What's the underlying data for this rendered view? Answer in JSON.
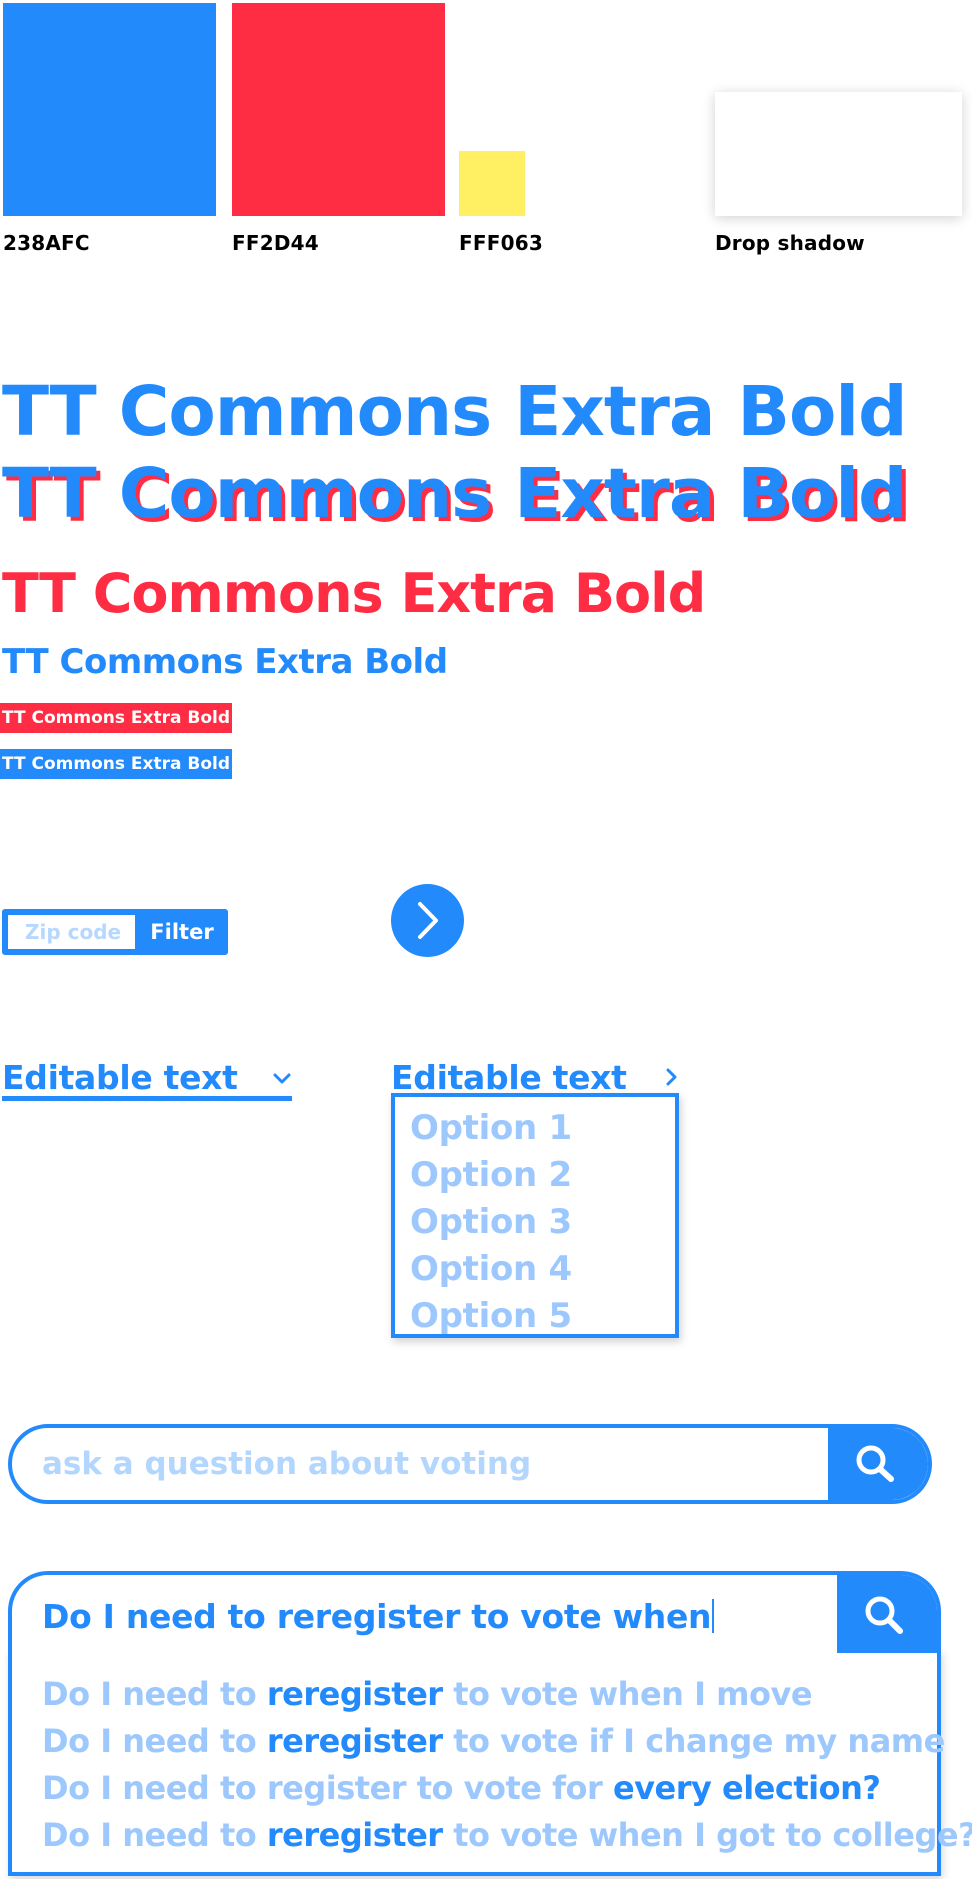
{
  "palette": {
    "swatches": [
      {
        "label": "238AFC",
        "color": "#238AFC"
      },
      {
        "label": "FF2D44",
        "color": "#FF2D44"
      },
      {
        "label": "FFF063",
        "color": "#FFF063"
      },
      {
        "label": "Drop shadow",
        "color": "#FFFFFF"
      }
    ]
  },
  "type_specimens": {
    "line1": "TT Commons Extra Bold",
    "line2": "TT Commons Extra Bold",
    "line3": "TT Commons Extra Bold",
    "line4": "TT Commons Extra Bold",
    "tag_red": "TT Commons Extra Bold",
    "tag_blue": "TT Commons Extra Bold"
  },
  "zip_filter": {
    "placeholder": "Zip code",
    "button_label": "Filter"
  },
  "next_button": {
    "icon": "chevron-right-icon"
  },
  "dropdown_closed": {
    "label": "Editable text",
    "icon": "chevron-down-icon"
  },
  "dropdown_open": {
    "label": "Editable text",
    "icon": "chevron-right-icon",
    "options": [
      "Option 1",
      "Option 2",
      "Option 3",
      "Option 4",
      "Option 5"
    ]
  },
  "search_empty": {
    "placeholder": "ask a question about voting",
    "icon": "search-icon"
  },
  "search_typing": {
    "value": "Do I need to reregister to vote when",
    "icon": "search-icon",
    "suggestions": [
      {
        "pre": "Do I need to ",
        "bold": "reregister",
        "post": " to vote when I move"
      },
      {
        "pre": "Do I need to ",
        "bold": "reregister",
        "post": " to vote if I change my name"
      },
      {
        "pre": "Do I need to register to vote for ",
        "bold": "every election?",
        "post": ""
      },
      {
        "pre": "Do I need to ",
        "bold": "reregister",
        "post": " to vote when I got to college?"
      }
    ]
  },
  "colors": {
    "blue": "#238AFC",
    "red": "#FF2D44",
    "yellow": "#FFF063",
    "light_blue": "#9DC8FD"
  }
}
